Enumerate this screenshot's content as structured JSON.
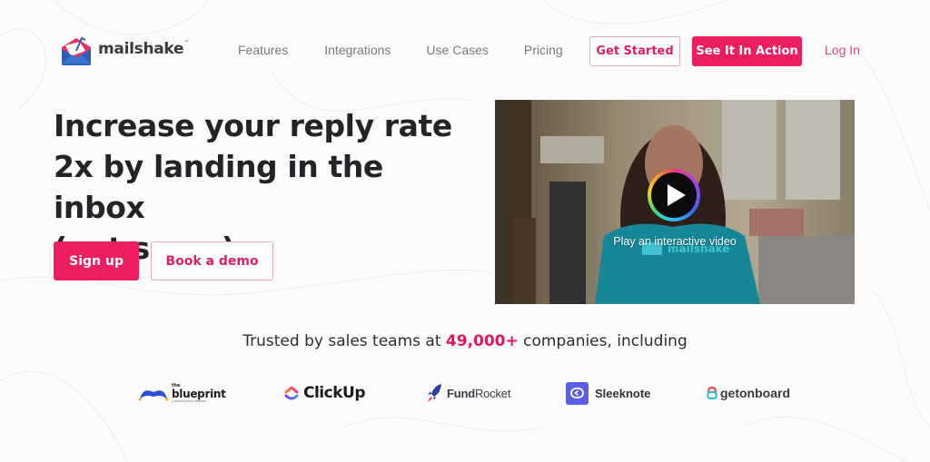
{
  "brand": {
    "name": "mailshake",
    "trademark": "™",
    "accent_color": "#ed1e5f"
  },
  "nav": {
    "items": [
      {
        "label": "Features"
      },
      {
        "label": "Integrations"
      },
      {
        "label": "Use Cases"
      },
      {
        "label": "Pricing"
      }
    ],
    "get_started_label": "Get Started",
    "see_it_in_action_label": "See It In Action",
    "login_label": "Log In"
  },
  "hero": {
    "headline_lines": [
      "Increase your reply rate",
      "2x by landing in the inbox",
      "(not spam)."
    ],
    "signup_label": "Sign up",
    "book_demo_label": "Book a demo"
  },
  "video": {
    "caption": "Play an interactive video",
    "play_icon": "play-icon",
    "shirt_text": "mailshake"
  },
  "trusted": {
    "prefix": "Trusted by sales teams at",
    "count": "49,000+",
    "suffix": "companies, including"
  },
  "customer_logos": [
    {
      "name": "blueprint",
      "prefix": "the",
      "subtitle": "A MOTLEY FOOL SERVICE"
    },
    {
      "name": "ClickUp"
    },
    {
      "name_bold": "Fund",
      "name_regular": "Rocket"
    },
    {
      "name": "Sleeknote"
    },
    {
      "name": "getonboard"
    }
  ]
}
